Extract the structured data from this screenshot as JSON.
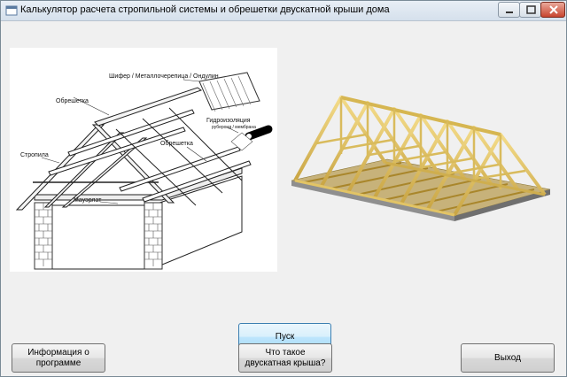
{
  "window": {
    "title": "Калькулятор расчета стропильной системы и обрешетки двускатной крыши дома"
  },
  "diagram": {
    "labels": {
      "roofing": "Шифер / Металлочерепица / Ондулин",
      "batten_top": "Обрешетка",
      "insulation": "Гидроизоляция",
      "insulation_sub": "рубероид / мембрана",
      "batten_right": "Обрешетка",
      "rafters": "Стропила",
      "wall_plate": "Мауэрлат"
    }
  },
  "buttons": {
    "start": "Пуск",
    "info": "Информация о программе",
    "what": "Что такое двускатная крыша?",
    "exit": "Выход"
  },
  "icons": {
    "app": "app-icon",
    "minimize": "minimize-icon",
    "maximize": "maximize-icon",
    "close": "close-icon"
  }
}
